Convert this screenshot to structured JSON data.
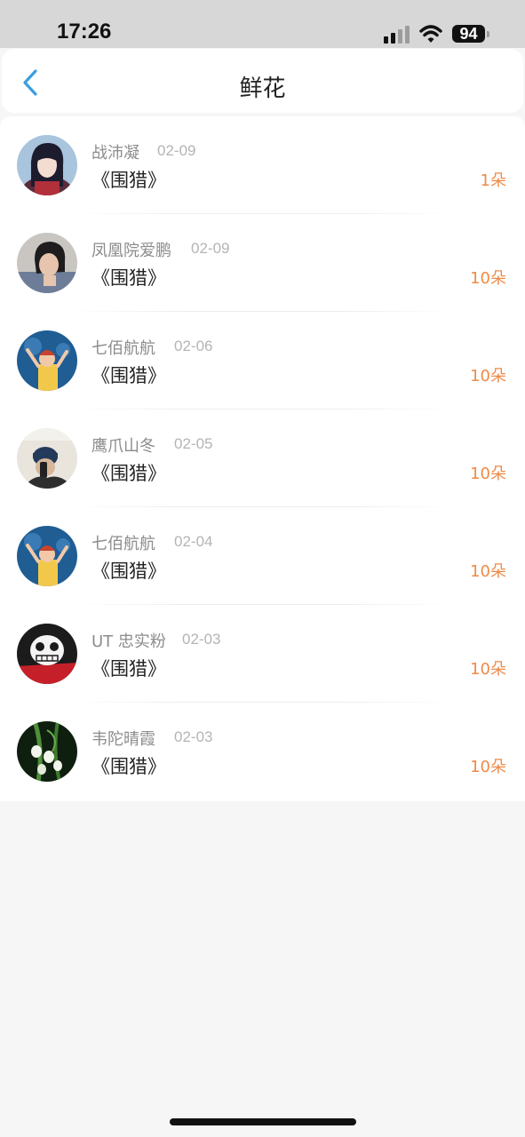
{
  "status_bar": {
    "time": "17:26",
    "battery": "94",
    "icons": [
      "signal-icon",
      "wifi-icon",
      "battery-icon"
    ]
  },
  "nav": {
    "back_icon": "chevron-left-icon",
    "title": "鲜花",
    "accent_color": "#3a9ee0"
  },
  "list": {
    "items": [
      {
        "user": "战沛凝",
        "date": "02-09",
        "book": "《围猎》",
        "amount": "1朵"
      },
      {
        "user": "凤凰院爱鹏",
        "date": "02-09",
        "book": "《围猎》",
        "amount": "10朵"
      },
      {
        "user": "七佰航航",
        "date": "02-06",
        "book": "《围猎》",
        "amount": "10朵"
      },
      {
        "user": "鹰爪山冬",
        "date": "02-05",
        "book": "《围猎》",
        "amount": "10朵"
      },
      {
        "user": "七佰航航",
        "date": "02-04",
        "book": "《围猎》",
        "amount": "10朵"
      },
      {
        "user": "UT 忠实粉",
        "date": "02-03",
        "book": "《围猎》",
        "amount": "10朵"
      },
      {
        "user": "韦陀晴霞",
        "date": "02-03",
        "book": "《围猎》",
        "amount": "10朵"
      }
    ],
    "amount_color": "#ef8a47"
  }
}
